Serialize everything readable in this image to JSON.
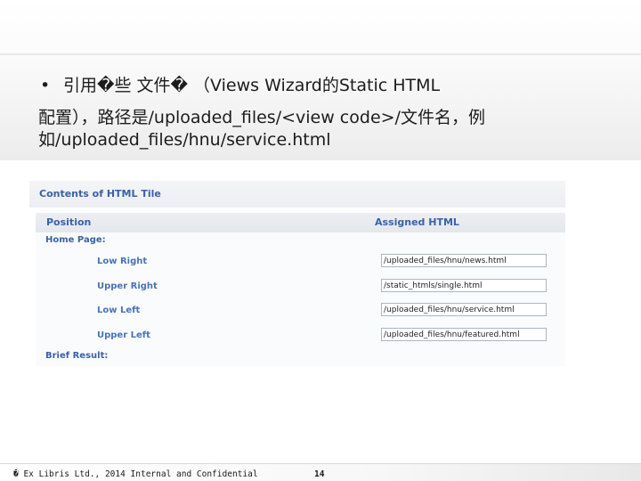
{
  "slide": {
    "line1": "引用�些 文件� （Views  Wizard的Static HTML",
    "line2": "配置），路径是/uploaded_files/<view code>/文件名，例",
    "line3": "如/uploaded_files/hnu/service.html",
    "bullet": "•"
  },
  "panel": {
    "title": "Contents of HTML Tile",
    "col_position": "Position",
    "col_assigned": "Assigned HTML",
    "home_page": "Home Page:",
    "rows": [
      {
        "label": "Low Right",
        "value": "/uploaded_files/hnu/news.html"
      },
      {
        "label": "Upper Right",
        "value": "/static_htmls/single.html"
      },
      {
        "label": "Low Left",
        "value": "/uploaded_files/hnu/service.html"
      },
      {
        "label": "Upper Left",
        "value": "/uploaded_files/hnu/featured.html"
      }
    ],
    "brief_result": "Brief Result:"
  },
  "footer": {
    "text": "� Ex Libris Ltd., 2014  Internal and Confidential",
    "page": "14"
  },
  "colors": {
    "panel_header_text": "#3a62a6",
    "row_label_text": "#4a72b8"
  }
}
